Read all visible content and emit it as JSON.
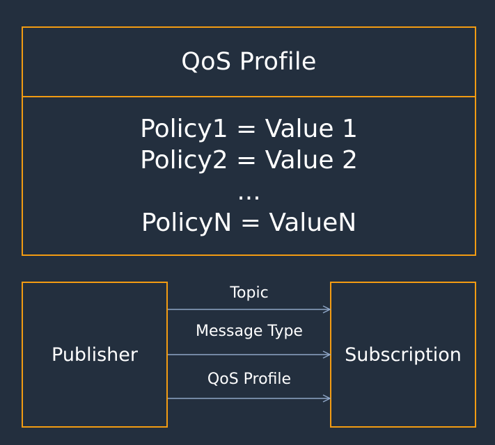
{
  "colors": {
    "background": "#232f3e",
    "border": "#f39c12",
    "arrow": "#8fa6c6",
    "text": "#ffffff"
  },
  "profile": {
    "title": "QoS Profile",
    "policies": [
      "Policy1 = Value 1",
      "Policy2 = Value 2",
      "...",
      "PolicyN = ValueN"
    ]
  },
  "publisher": {
    "label": "Publisher"
  },
  "subscription": {
    "label": "Subscription"
  },
  "edges": [
    {
      "label": "Topic"
    },
    {
      "label": "Message Type"
    },
    {
      "label": "QoS Profile"
    }
  ]
}
